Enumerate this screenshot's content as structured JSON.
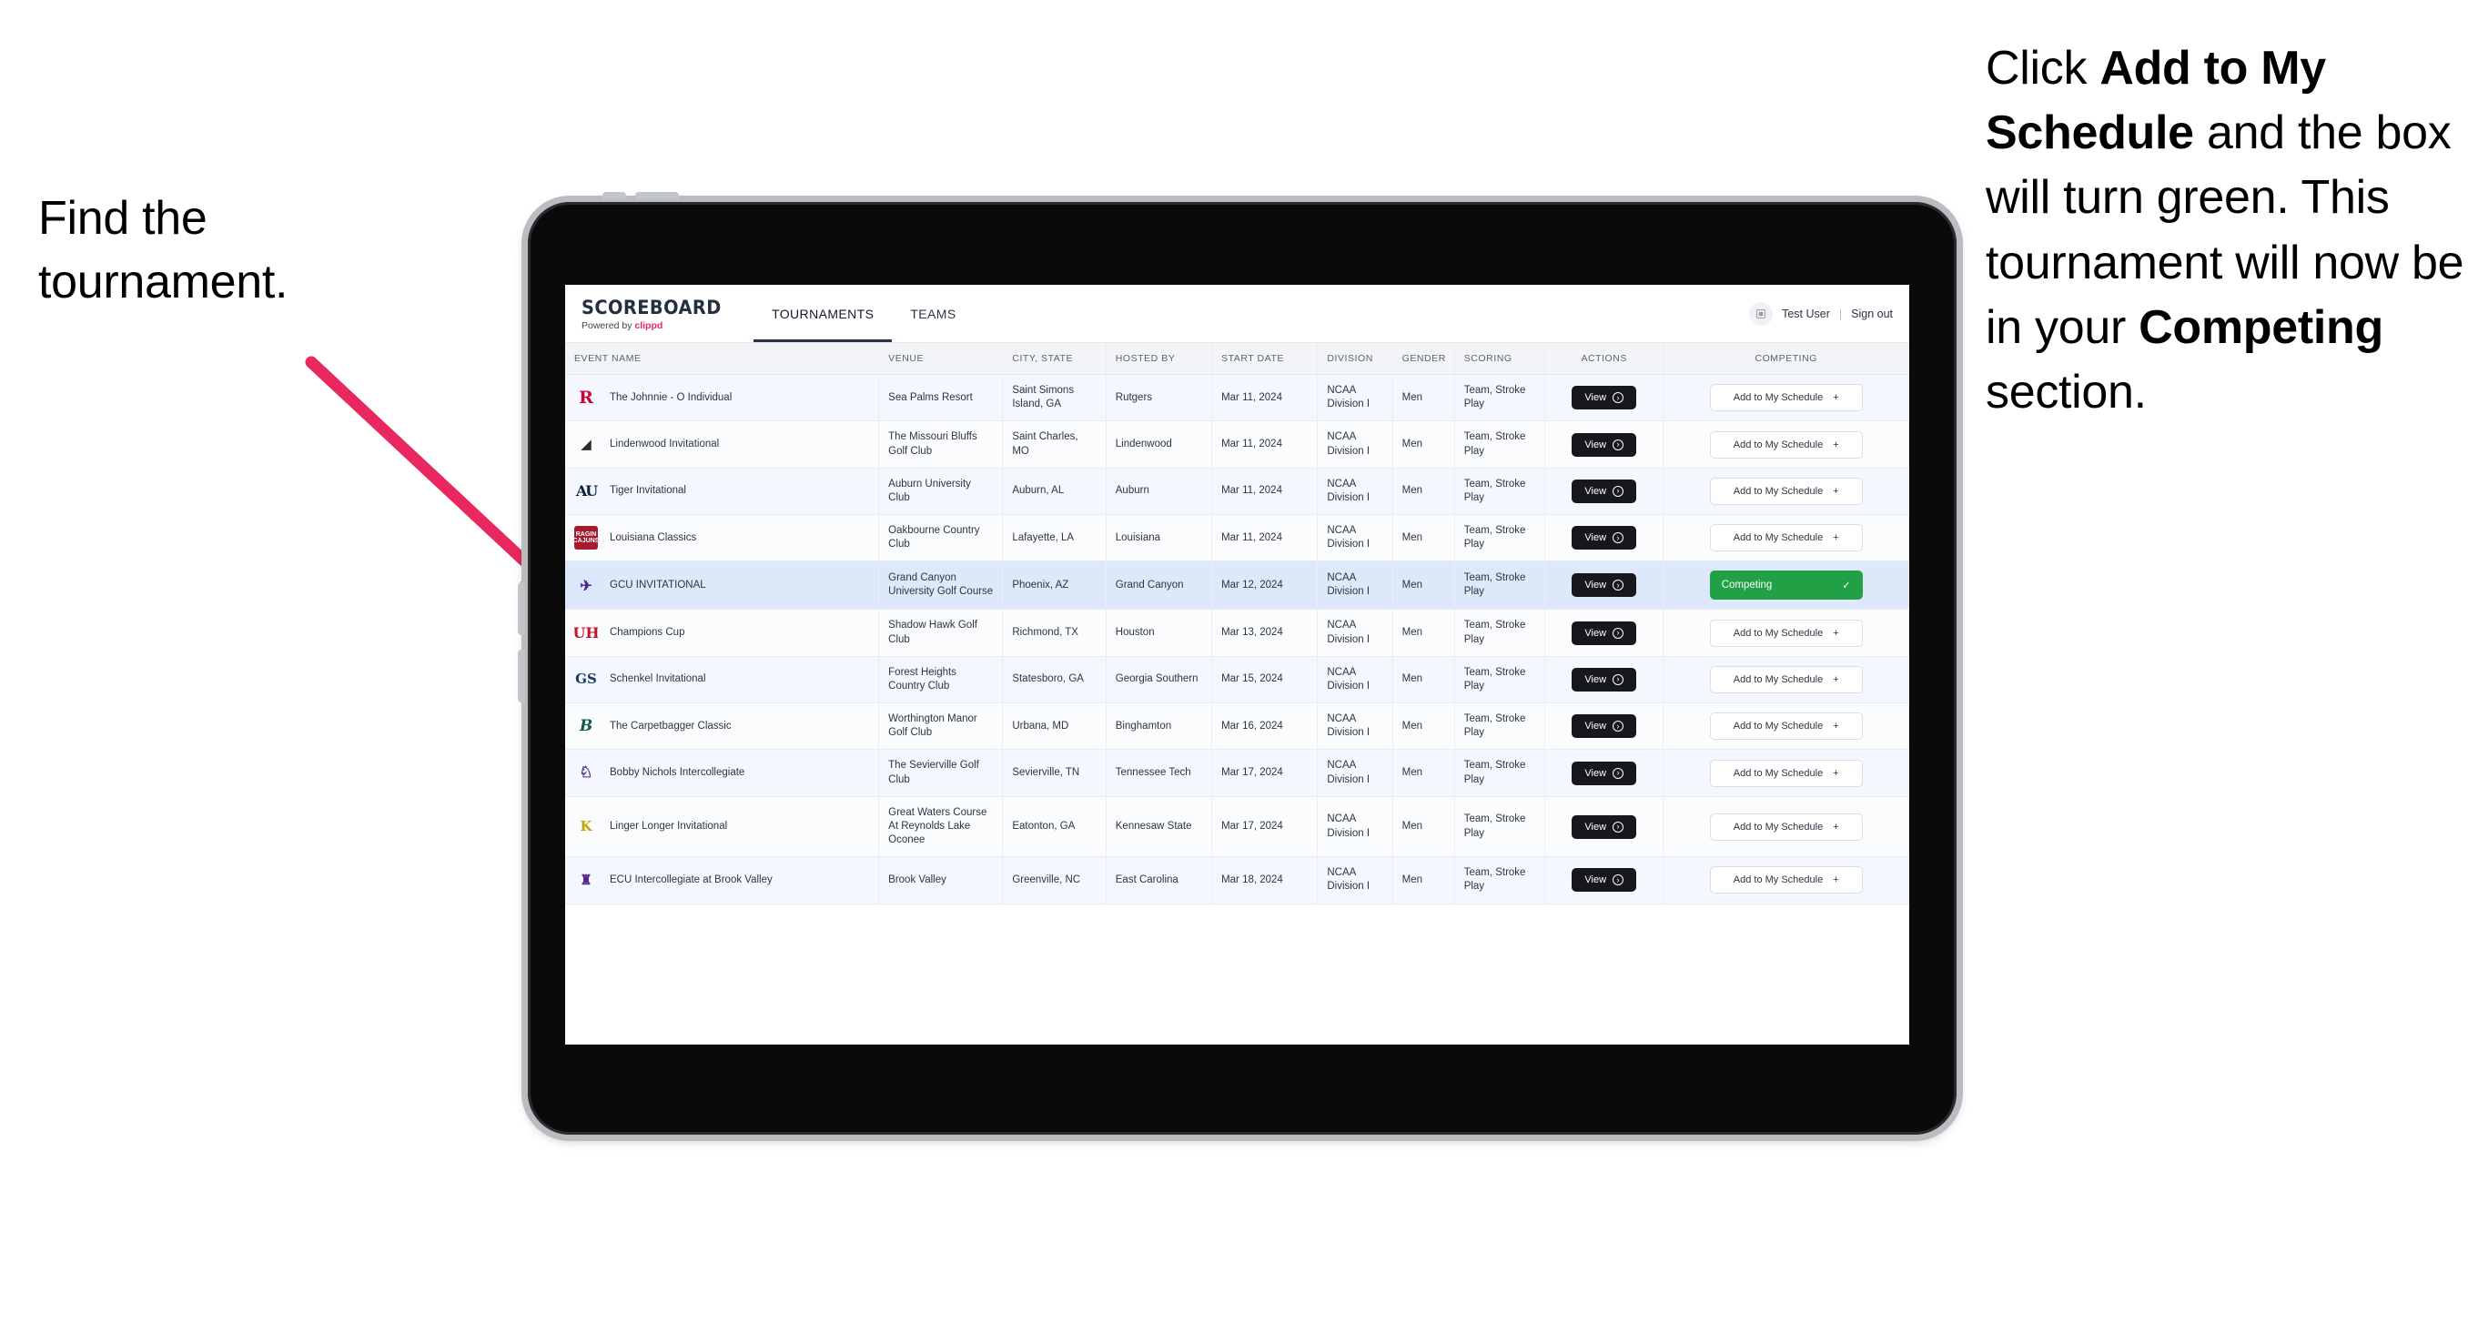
{
  "annotations": {
    "left": "Find the tournament.",
    "right_parts": [
      {
        "text": "Click ",
        "bold": false
      },
      {
        "text": "Add to My Schedule",
        "bold": true
      },
      {
        "text": " and the box will turn green. This tournament will now be in your ",
        "bold": false
      },
      {
        "text": "Competing",
        "bold": true
      },
      {
        "text": " section.",
        "bold": false
      }
    ],
    "arrow_color": "#e8285f"
  },
  "app": {
    "brand_title": "SCOREBOARD",
    "brand_sub_prefix": "Powered by ",
    "brand_sub_name": "clippd",
    "tabs": [
      {
        "label": "TOURNAMENTS",
        "active": true
      },
      {
        "label": "TEAMS",
        "active": false
      }
    ],
    "user": {
      "avatar_icon": "user-badge-icon",
      "name": "Test User",
      "separator": "|",
      "signout": "Sign out"
    }
  },
  "table": {
    "columns": [
      "EVENT NAME",
      "VENUE",
      "CITY, STATE",
      "HOSTED BY",
      "START DATE",
      "DIVISION",
      "GENDER",
      "SCORING",
      "ACTIONS",
      "COMPETING"
    ],
    "view_label": "View",
    "add_label": "Add to My Schedule",
    "add_icon": "plus-icon",
    "competing_label": "Competing",
    "competing_icon": "check-icon",
    "view_icon": "arrow-circle-right-icon",
    "competing_color": "#22a045",
    "rows": [
      {
        "logo": "R",
        "logo_class": "mark-R",
        "event": "The Johnnie - O Individual",
        "venue": "Sea Palms Resort",
        "city": "Saint Simons Island, GA",
        "host": "Rutgers",
        "date": "Mar 11, 2024",
        "division": "NCAA Division I",
        "gender": "Men",
        "scoring": "Team, Stroke Play",
        "competing": false
      },
      {
        "logo": "◢",
        "logo_class": "mark-LU",
        "event": "Lindenwood Invitational",
        "venue": "The Missouri Bluffs Golf Club",
        "city": "Saint Charles, MO",
        "host": "Lindenwood",
        "date": "Mar 11, 2024",
        "division": "NCAA Division I",
        "gender": "Men",
        "scoring": "Team, Stroke Play",
        "competing": false
      },
      {
        "logo": "AU",
        "logo_class": "mark-AU",
        "event": "Tiger Invitational",
        "venue": "Auburn University Club",
        "city": "Auburn, AL",
        "host": "Auburn",
        "date": "Mar 11, 2024",
        "division": "NCAA Division I",
        "gender": "Men",
        "scoring": "Team, Stroke Play",
        "competing": false
      },
      {
        "logo": "RAGIN CAJUNS",
        "logo_class": "mark-LA",
        "event": "Louisiana Classics",
        "venue": "Oakbourne Country Club",
        "city": "Lafayette, LA",
        "host": "Louisiana",
        "date": "Mar 11, 2024",
        "division": "NCAA Division I",
        "gender": "Men",
        "scoring": "Team, Stroke Play",
        "competing": false
      },
      {
        "logo": "✈",
        "logo_class": "mark-GCU",
        "event": "GCU INVITATIONAL",
        "venue": "Grand Canyon University Golf Course",
        "city": "Phoenix, AZ",
        "host": "Grand Canyon",
        "date": "Mar 12, 2024",
        "division": "NCAA Division I",
        "gender": "Men",
        "scoring": "Team, Stroke Play",
        "competing": true
      },
      {
        "logo": "UH",
        "logo_class": "mark-UH",
        "event": "Champions Cup",
        "venue": "Shadow Hawk Golf Club",
        "city": "Richmond, TX",
        "host": "Houston",
        "date": "Mar 13, 2024",
        "division": "NCAA Division I",
        "gender": "Men",
        "scoring": "Team, Stroke Play",
        "competing": false
      },
      {
        "logo": "GS",
        "logo_class": "mark-GS",
        "event": "Schenkel Invitational",
        "venue": "Forest Heights Country Club",
        "city": "Statesboro, GA",
        "host": "Georgia Southern",
        "date": "Mar 15, 2024",
        "division": "NCAA Division I",
        "gender": "Men",
        "scoring": "Team, Stroke Play",
        "competing": false
      },
      {
        "logo": "B",
        "logo_class": "mark-BG",
        "event": "The Carpetbagger Classic",
        "venue": "Worthington Manor Golf Club",
        "city": "Urbana, MD",
        "host": "Binghamton",
        "date": "Mar 16, 2024",
        "division": "NCAA Division I",
        "gender": "Men",
        "scoring": "Team, Stroke Play",
        "competing": false
      },
      {
        "logo": "♘",
        "logo_class": "mark-TT",
        "event": "Bobby Nichols Intercollegiate",
        "venue": "The Sevierville Golf Club",
        "city": "Sevierville, TN",
        "host": "Tennessee Tech",
        "date": "Mar 17, 2024",
        "division": "NCAA Division I",
        "gender": "Men",
        "scoring": "Team, Stroke Play",
        "competing": false
      },
      {
        "logo": "K",
        "logo_class": "mark-KS",
        "event": "Linger Longer Invitational",
        "venue": "Great Waters Course At Reynolds Lake Oconee",
        "city": "Eatonton, GA",
        "host": "Kennesaw State",
        "date": "Mar 17, 2024",
        "division": "NCAA Division I",
        "gender": "Men",
        "scoring": "Team, Stroke Play",
        "competing": false
      },
      {
        "logo": "♜",
        "logo_class": "mark-EC",
        "event": "ECU Intercollegiate at Brook Valley",
        "venue": "Brook Valley",
        "city": "Greenville, NC",
        "host": "East Carolina",
        "date": "Mar 18, 2024",
        "division": "NCAA Division I",
        "gender": "Men",
        "scoring": "Team, Stroke Play",
        "competing": false
      }
    ]
  }
}
